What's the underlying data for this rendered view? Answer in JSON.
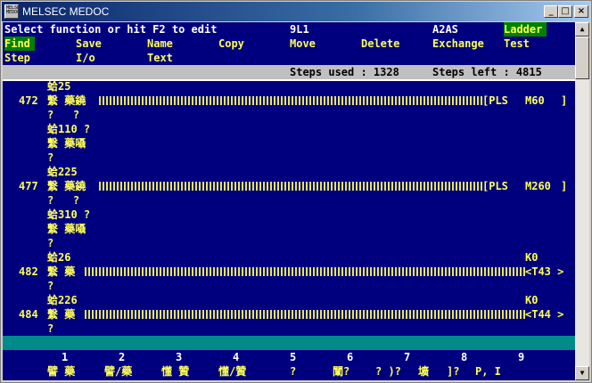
{
  "window": {
    "title": "MELSEC MEDOC",
    "icon_text": "MELSEC MEDOC",
    "minimize": "_",
    "maximize": "□",
    "close": "×"
  },
  "header": {
    "prompt": "Select function or hit F2 to edit",
    "program": "9L1",
    "cpu": "A2AS",
    "mode": "Ladder"
  },
  "menu": {
    "row1": [
      "Find",
      "Save",
      "Name",
      "Copy",
      "Move",
      "Delete",
      "Exchange",
      "Test"
    ],
    "row2": [
      "Step",
      "I/o",
      "Text"
    ]
  },
  "status": {
    "steps_used": "Steps used : 1328",
    "steps_left": "Steps left : 4815"
  },
  "ladder": {
    "r472": {
      "step": "472",
      "dev_label": "蛤25",
      "contact": "繫 藥鐃",
      "coil_left": "[PLS",
      "coil_dev": "M60",
      "coil_right": "]",
      "sub1": "?   ?"
    },
    "r472b": {
      "dev_label": "蛤110 ?",
      "contact": "繫 藥囁",
      "sub": "?"
    },
    "r477": {
      "step": "477",
      "dev_label": "蛤225",
      "contact": "繫 藥鐃",
      "coil_left": "[PLS",
      "coil_dev": "M260",
      "coil_right": "]",
      "sub1": "?   ?"
    },
    "r477b": {
      "dev_label": "蛤310 ?",
      "contact": "繫 藥囁",
      "sub": "?"
    },
    "r482": {
      "step": "482",
      "dev_label": "蛤26",
      "contact": "繫 藥",
      "const": "K0",
      "timer": "<T43 >",
      "sub": "?"
    },
    "r484": {
      "step": "484",
      "dev_label": "蛤226",
      "contact": "繫 藥",
      "const": "K0",
      "timer": "<T44 >",
      "sub": "?"
    }
  },
  "fkeys": {
    "numbers": [
      "1",
      "2",
      "3",
      "4",
      "5",
      "6",
      "7",
      "8",
      "9"
    ],
    "labels": [
      "譬 藥",
      "譬/藥",
      "懂 贊",
      "懂/贊",
      "?",
      "闡?",
      "? )?",
      "壙",
      "]?",
      "P, I"
    ]
  },
  "scrollbar": {
    "up": "▲",
    "down": "▼"
  },
  "colors": {
    "screen_bg": "#00007f",
    "text_white": "#ffffff",
    "text_yellow": "#ffff55",
    "highlight": "#008000",
    "status_bar": "#c0c0c0",
    "teal_bar": "#008b8b"
  }
}
